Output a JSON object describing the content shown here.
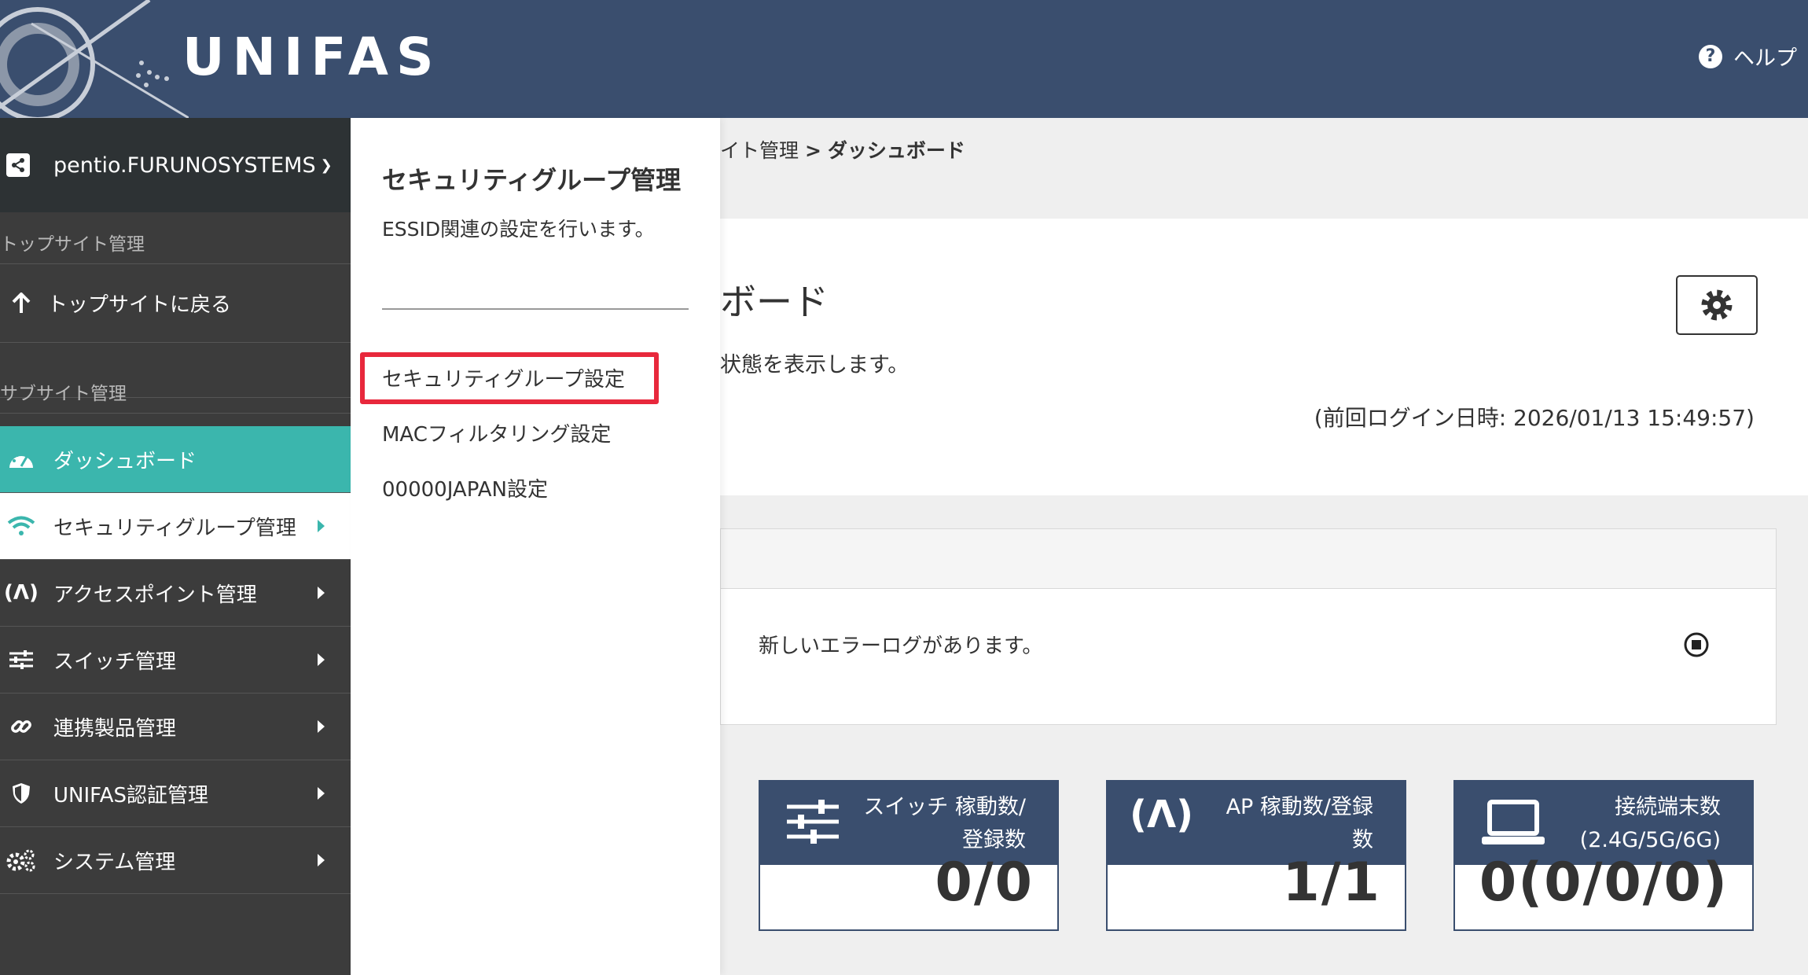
{
  "header": {
    "logo": "UNIFAS",
    "help_label": "ヘルプ",
    "help_icon": "question-circle-icon"
  },
  "sidebar": {
    "site_name": "pentio.FURUNOSYSTEMS",
    "top_section_label": "トップサイト管理",
    "back_to_top_label": "トップサイトに戻る",
    "sub_section_label": "サブサイト管理",
    "items": [
      {
        "label": "ダッシュボード",
        "icon": "dashboard-gauge-icon",
        "state": "active"
      },
      {
        "label": "セキュリティグループ管理",
        "icon": "wifi-icon",
        "state": "selected"
      },
      {
        "label": "アクセスポイント管理",
        "icon": "access-point-icon",
        "state": "normal"
      },
      {
        "label": "スイッチ管理",
        "icon": "sliders-icon",
        "state": "normal"
      },
      {
        "label": "連携製品管理",
        "icon": "link-icon",
        "state": "normal"
      },
      {
        "label": "UNIFAS認証管理",
        "icon": "shield-icon",
        "state": "normal"
      },
      {
        "label": "システム管理",
        "icon": "gears-icon",
        "state": "normal"
      }
    ]
  },
  "flyout": {
    "title": "セキュリティグループ管理",
    "description": "ESSID関連の設定を行います。",
    "links": [
      "セキュリティグループ設定",
      "MACフィルタリング設定",
      "00000JAPAN設定"
    ]
  },
  "main": {
    "breadcrumb_parent": "イト管理",
    "breadcrumb_sep": ">",
    "breadcrumb_current": "ダッシュボード",
    "dashboard_title": "ボード",
    "dashboard_desc": "状態を表示します。",
    "last_login": "(前回ログイン日時: 2026/01/13 15:49:57)",
    "error_message": "新しいエラーログがあります。",
    "stats": [
      {
        "label_line1": "スイッチ 稼動数/",
        "label_line2": "登録数",
        "value": "0/0",
        "icon": "sliders-icon"
      },
      {
        "label_line1": "AP 稼動数/登録",
        "label_line2": "数",
        "value": "1/1",
        "icon": "access-point-icon"
      },
      {
        "label_line1": "接続端末数",
        "label_line2": "(2.4G/5G/6G)",
        "value": "0(0/0/0)",
        "icon": "laptop-icon"
      }
    ]
  },
  "colors": {
    "header_bg": "#3a4e6e",
    "sidebar_bg": "#3c3c3c",
    "accent_teal": "#3bb6ad",
    "highlight_red": "#e8283c"
  }
}
